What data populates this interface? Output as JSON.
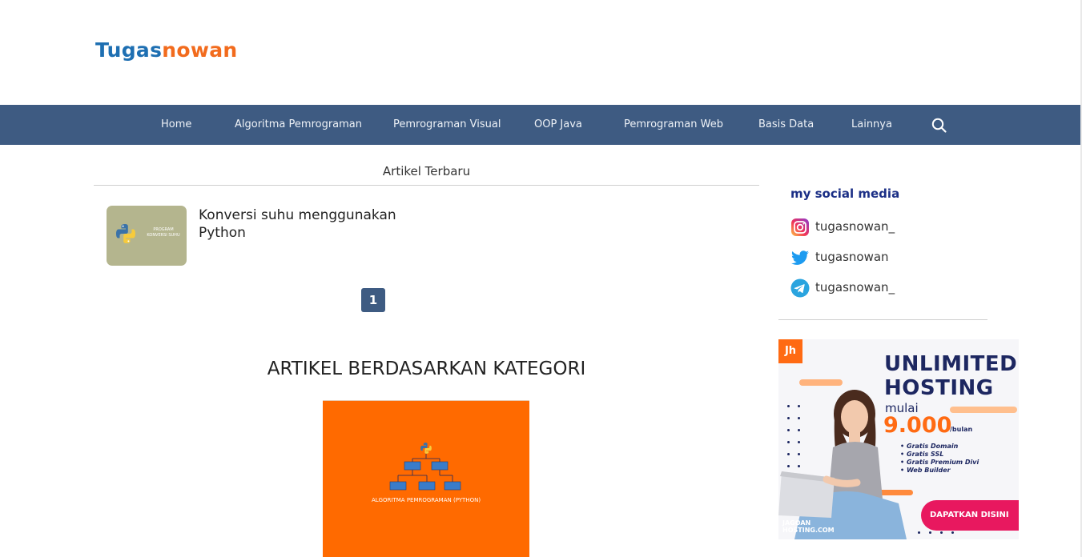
{
  "header": {
    "logo_part_a": "Tugas",
    "logo_part_b": "nowan"
  },
  "nav": {
    "items": [
      {
        "label": "Home"
      },
      {
        "label": "Algoritma Pemrograman"
      },
      {
        "label": "Pemrograman Visual"
      },
      {
        "label": "OOP Java"
      },
      {
        "label": "Pemrograman Web"
      },
      {
        "label": "Basis Data"
      },
      {
        "label": "Lainnya"
      }
    ],
    "search_icon": "search-icon"
  },
  "main": {
    "section_title": "Artikel Terbaru",
    "articles": [
      {
        "title": "Konversi suhu menggunakan Python",
        "thumb_text": "PROGRAM KONVERSI SUHU",
        "thumb_icon": "python-logo-icon"
      }
    ],
    "pagination": {
      "current": "1"
    },
    "category_heading": "ARTIKEL BERDASARKAN KATEGORI",
    "category_card": {
      "label": "ALGORITMA PEMROGRAMAN (PYTHON)",
      "icon": "python-logo-icon"
    }
  },
  "sidebar": {
    "social_heading": "my social media",
    "social": [
      {
        "icon": "instagram-icon",
        "handle": "tugasnowan_"
      },
      {
        "icon": "twitter-icon",
        "handle": "tugasnowan"
      },
      {
        "icon": "telegram-icon",
        "handle": "tugasnowan_"
      }
    ],
    "ad": {
      "badge": "Jh",
      "headline_1": "UNLIMITED",
      "headline_2": "HOSTING",
      "mulai": "mulai",
      "price": "9.000",
      "per": "/bulan",
      "features": [
        "Gratis Domain",
        "Gratis SSL",
        "Gratis Premium Divi",
        "Web Builder"
      ],
      "cta": "DAPATKAN DISINI",
      "brand_1": "JAGOAN",
      "brand_2": "HOSTING.COM"
    }
  },
  "colors": {
    "nav_bg": "#3e5b82",
    "logo_blue": "#1e6fb2",
    "logo_orange": "#f26b1d",
    "category_orange": "#ff6a00",
    "social_heading": "#1b2f86",
    "cta_pink": "#e8185f"
  }
}
